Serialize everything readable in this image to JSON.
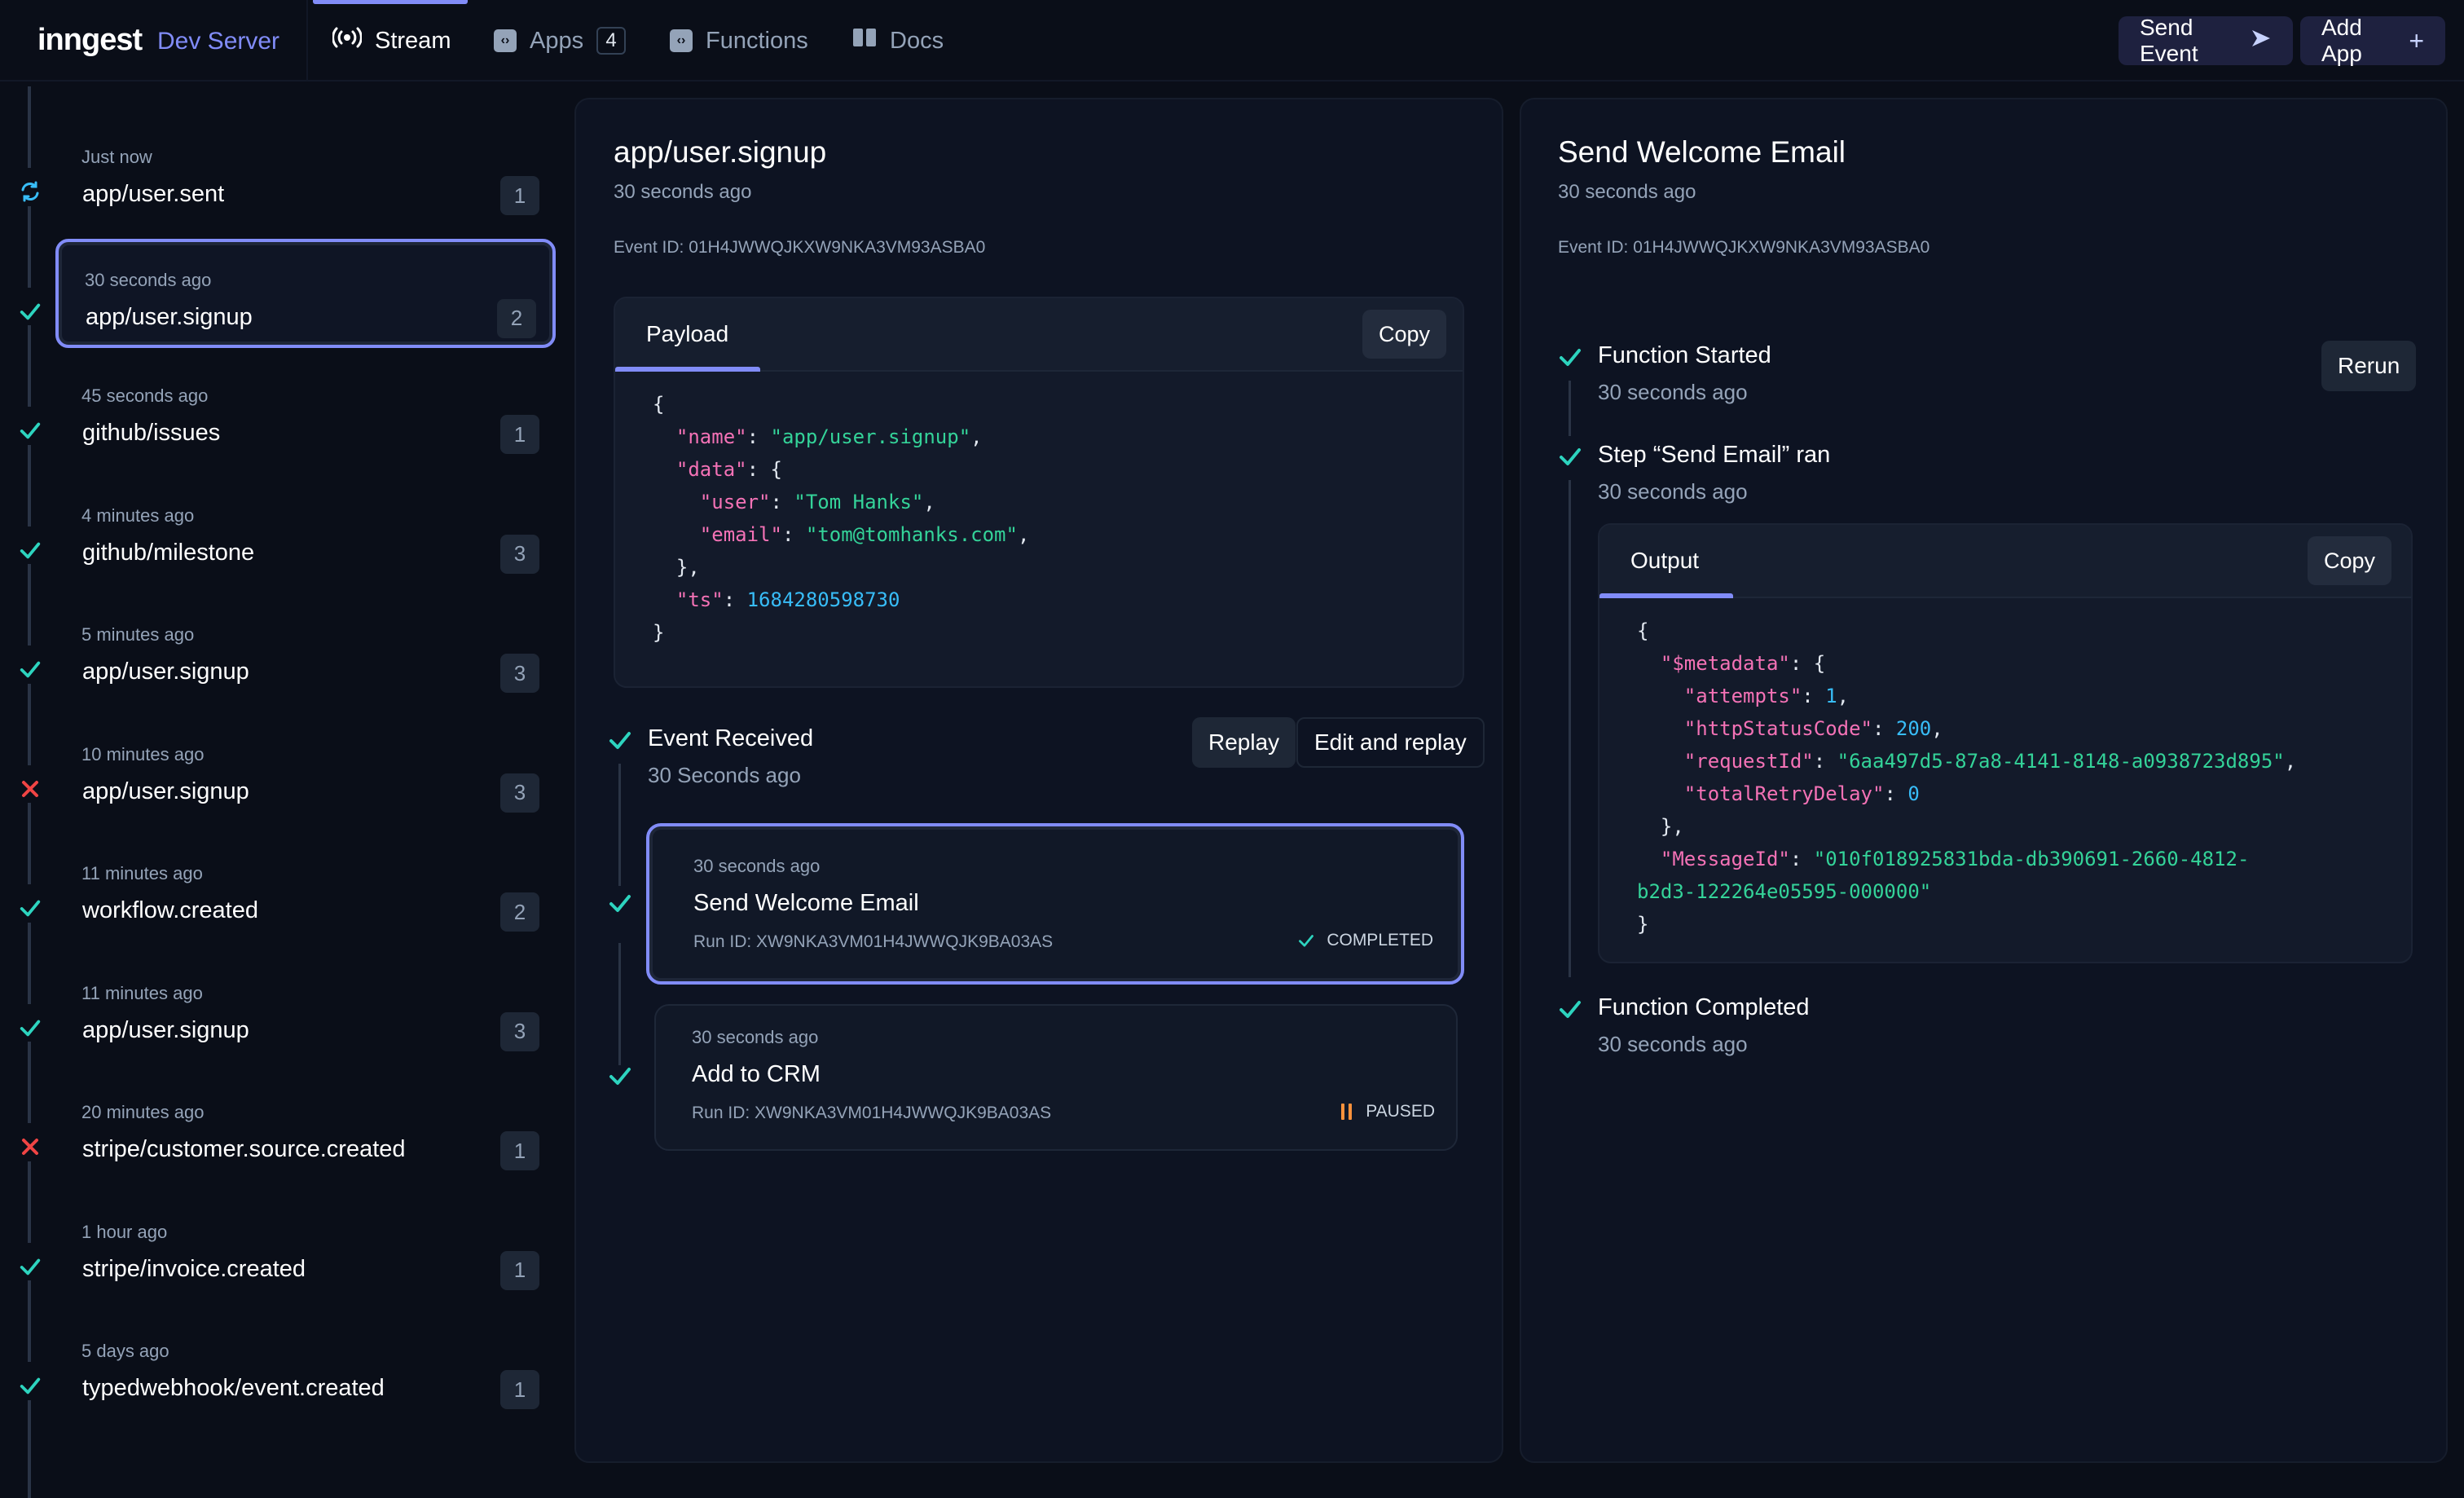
{
  "header": {
    "logo": "inngest",
    "logo_sub": "Dev Server",
    "nav": [
      {
        "label": "Stream",
        "icon": "broadcast-icon",
        "active": true
      },
      {
        "label": "Apps",
        "icon": "code-icon",
        "count": "4"
      },
      {
        "label": "Functions",
        "icon": "code-icon"
      },
      {
        "label": "Docs",
        "icon": "book-icon"
      }
    ],
    "send_event_label": "Send Event",
    "add_app_label": "Add App"
  },
  "colors": {
    "accent": "#818cf8",
    "success": "#2dd4bf",
    "error": "#f04444",
    "running": "#38bdf8",
    "paused": "#fb923c"
  },
  "events": [
    {
      "time": "Just now",
      "name": "app/user.sent",
      "count": "1",
      "status": "running"
    },
    {
      "time": "30 seconds ago",
      "name": "app/user.signup",
      "count": "2",
      "status": "success",
      "selected": true
    },
    {
      "time": "45 seconds ago",
      "name": "github/issues",
      "count": "1",
      "status": "success"
    },
    {
      "time": "4 minutes ago",
      "name": "github/milestone",
      "count": "3",
      "status": "success"
    },
    {
      "time": "5 minutes ago",
      "name": "app/user.signup",
      "count": "3",
      "status": "success"
    },
    {
      "time": "10 minutes ago",
      "name": "app/user.signup",
      "count": "3",
      "status": "failed"
    },
    {
      "time": "11 minutes ago",
      "name": "workflow.created",
      "count": "2",
      "status": "success"
    },
    {
      "time": "11 minutes ago",
      "name": "app/user.signup",
      "count": "3",
      "status": "success"
    },
    {
      "time": "20 minutes ago",
      "name": "stripe/customer.source.created",
      "count": "1",
      "status": "failed"
    },
    {
      "time": "1 hour ago",
      "name": "stripe/invoice.created",
      "count": "1",
      "status": "success"
    },
    {
      "time": "5 days ago",
      "name": "typedwebhook/event.created",
      "count": "1",
      "status": "success"
    }
  ],
  "event_detail": {
    "title": "app/user.signup",
    "time": "30 seconds ago",
    "event_id": "Event ID: 01H4JWWQJKXW9NKA3VM93ASBA0",
    "payload_tab": "Payload",
    "copy_label": "Copy",
    "payload": {
      "name": "app/user.signup",
      "user": "Tom Hanks",
      "email": "tom@tomhanks.com",
      "ts": "1684280598730"
    },
    "received_title": "Event Received",
    "received_time": "30 Seconds ago",
    "replay_label": "Replay",
    "edit_replay_label": "Edit and replay",
    "runs": [
      {
        "time": "30 seconds ago",
        "name": "Send Welcome Email",
        "run_id": "Run ID: XW9NKA3VM01H4JWWQJK9BA03AS",
        "status": "COMPLETED",
        "selected": true
      },
      {
        "time": "30 seconds ago",
        "name": "Add to CRM",
        "run_id": "Run ID: XW9NKA3VM01H4JWWQJK9BA03AS",
        "status": "PAUSED"
      }
    ]
  },
  "run_detail": {
    "title": "Send Welcome Email",
    "time": "30 seconds ago",
    "event_id": "Event ID: 01H4JWWQJKXW9NKA3VM93ASBA0",
    "rerun_label": "Rerun",
    "output_tab": "Output",
    "copy_label": "Copy",
    "steps": [
      {
        "title": "Function Started",
        "time": "30 seconds ago"
      },
      {
        "title": "Step “Send Email” ran",
        "time": "30 seconds ago"
      },
      {
        "title": "Function Completed",
        "time": "30 seconds ago"
      }
    ],
    "output": {
      "attempts": "1",
      "httpStatusCode": "200",
      "requestId": "6aa497d5-87a8-4141-8148-a0938723d895",
      "totalRetryDelay": "0",
      "MessageId_line1": "010f018925831bda-db390691-2660-4812-",
      "MessageId_line2": "b2d3-122264e05595-000000"
    }
  }
}
